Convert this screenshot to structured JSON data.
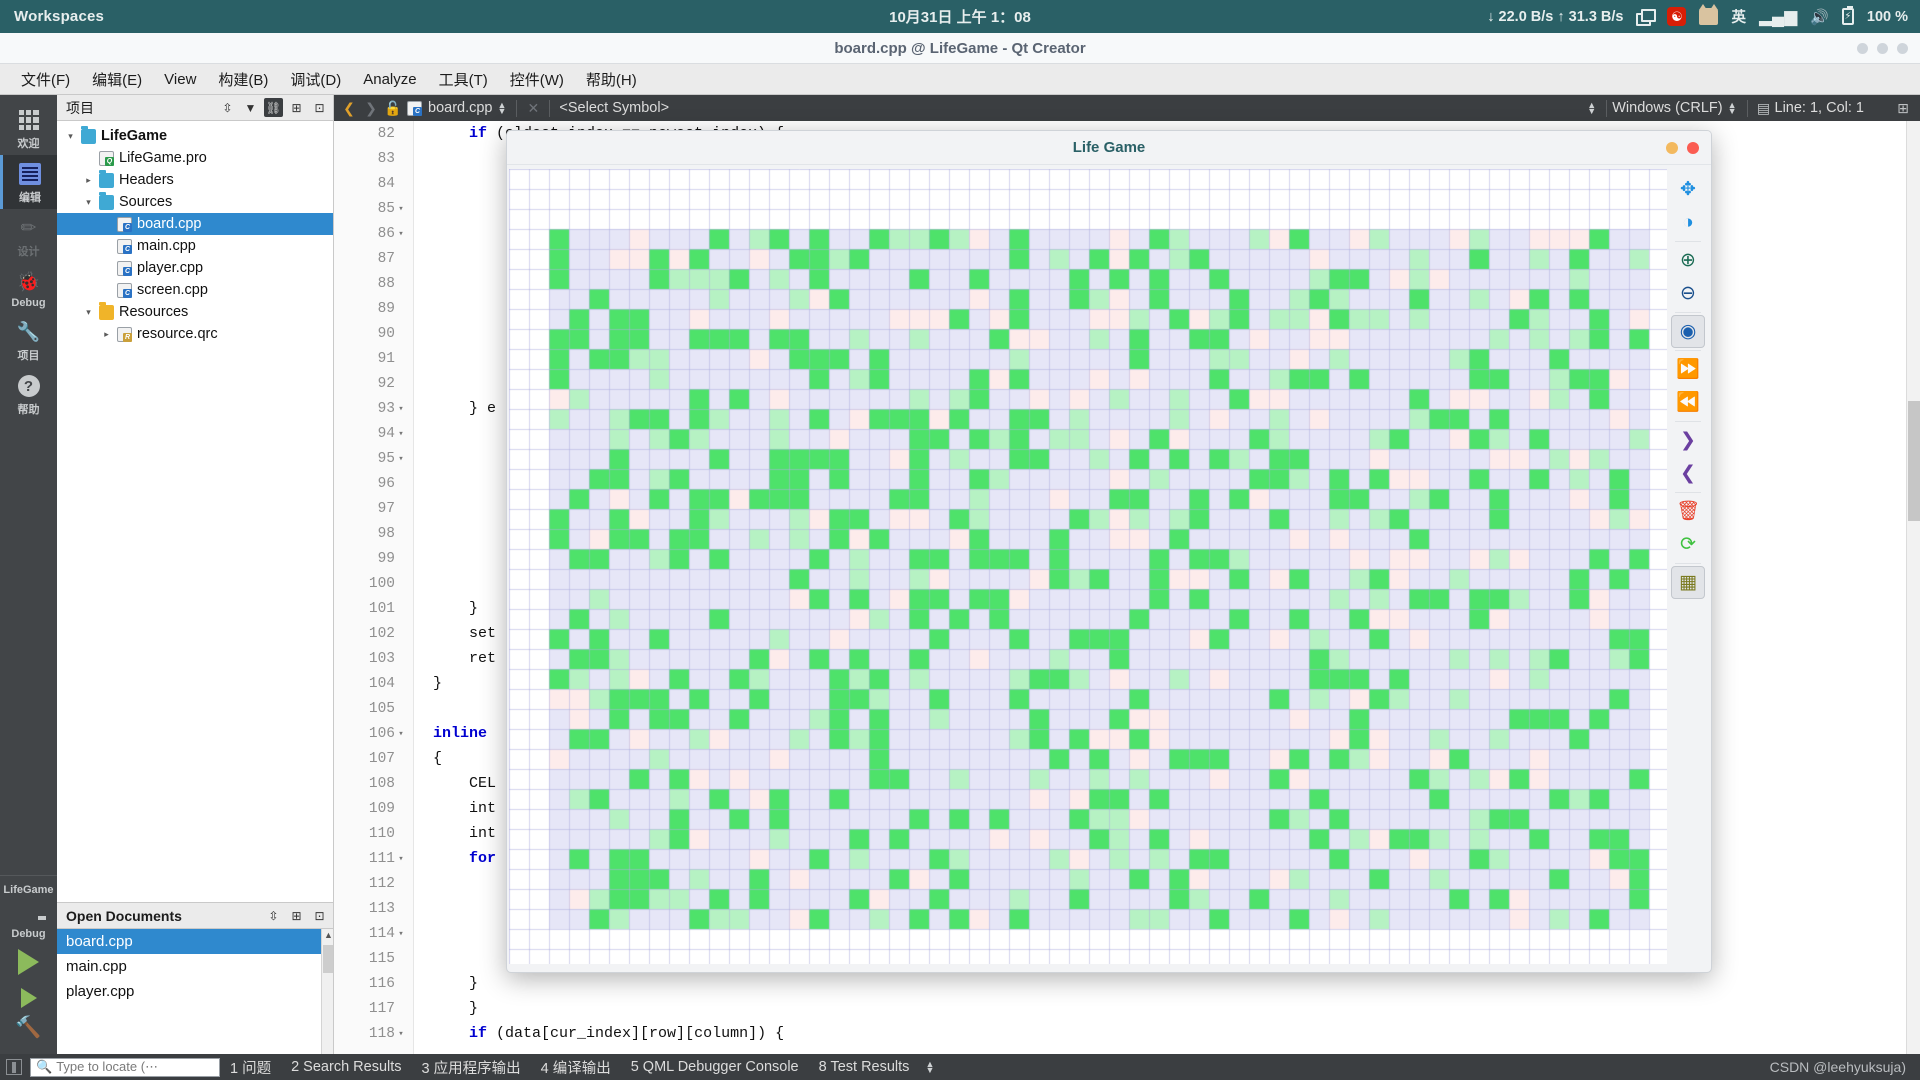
{
  "systembar": {
    "workspaces": "Workspaces",
    "clock": "10月31日 上午 1：08",
    "network": "↓ 22.0 B/s ↑ 31.3 B/s",
    "ime": "英",
    "battery": "100 %",
    "icons": [
      "windows-switch-icon",
      "netease-music-icon",
      "cat-icon",
      "wifi-icon",
      "volume-icon",
      "battery-icon"
    ],
    "bg": "#2a6066"
  },
  "qt_window": {
    "title": "board.cpp @ LifeGame - Qt Creator"
  },
  "menubar": {
    "items": [
      {
        "label": "文件(F)"
      },
      {
        "label": "编辑(E)"
      },
      {
        "label": "View"
      },
      {
        "label": "构建(B)"
      },
      {
        "label": "调试(D)"
      },
      {
        "label": "Analyze"
      },
      {
        "label": "工具(T)"
      },
      {
        "label": "控件(W)"
      },
      {
        "label": "帮助(H)"
      }
    ]
  },
  "modebar": {
    "items": [
      {
        "label": "欢迎",
        "icon": "grid-icon",
        "state": "normal"
      },
      {
        "label": "编辑",
        "icon": "edit-lines-icon",
        "state": "active"
      },
      {
        "label": "设计",
        "icon": "pencil-icon",
        "state": "disabled"
      },
      {
        "label": "Debug",
        "icon": "bug-icon",
        "state": "normal"
      },
      {
        "label": "项目",
        "icon": "wrench-icon",
        "state": "normal"
      },
      {
        "label": "帮助",
        "icon": "question-circle-icon",
        "state": "normal"
      }
    ],
    "kit": {
      "project": "LifeGame",
      "build_config": "Debug",
      "icon": "monitor-icon"
    },
    "run_buttons": [
      {
        "name": "run-button",
        "icon": "play-triangle-icon"
      },
      {
        "name": "debug-button",
        "icon": "play-bug-icon"
      },
      {
        "name": "build-button",
        "icon": "hammer-icon"
      }
    ]
  },
  "project_panel": {
    "title": "项目",
    "header_buttons": [
      "sort-stepper-icon",
      "filter-icon",
      "link-sync-icon",
      "split-icon",
      "close-panel-icon"
    ],
    "tree": [
      {
        "label": "LifeGame",
        "depth": 0,
        "arrow": "▾",
        "icon": "project-folder-icon",
        "bold": true,
        "selected": false
      },
      {
        "label": "LifeGame.pro",
        "depth": 1,
        "arrow": "",
        "icon": "qt-pro-file-icon",
        "bold": false,
        "selected": false
      },
      {
        "label": "Headers",
        "depth": 1,
        "arrow": "▸",
        "icon": "headers-folder-icon",
        "bold": false,
        "selected": false
      },
      {
        "label": "Sources",
        "depth": 1,
        "arrow": "▾",
        "icon": "sources-folder-icon",
        "bold": false,
        "selected": false
      },
      {
        "label": "board.cpp",
        "depth": 2,
        "arrow": "",
        "icon": "cpp-file-icon",
        "bold": false,
        "selected": true
      },
      {
        "label": "main.cpp",
        "depth": 2,
        "arrow": "",
        "icon": "cpp-file-icon",
        "bold": false,
        "selected": false
      },
      {
        "label": "player.cpp",
        "depth": 2,
        "arrow": "",
        "icon": "cpp-file-icon",
        "bold": false,
        "selected": false
      },
      {
        "label": "screen.cpp",
        "depth": 2,
        "arrow": "",
        "icon": "cpp-file-icon",
        "bold": false,
        "selected": false
      },
      {
        "label": "Resources",
        "depth": 1,
        "arrow": "▾",
        "icon": "resources-folder-icon",
        "bold": false,
        "selected": false
      },
      {
        "label": "resource.qrc",
        "depth": 2,
        "arrow": "▸",
        "icon": "qrc-file-icon",
        "bold": false,
        "selected": false
      }
    ]
  },
  "open_documents": {
    "title": "Open Documents",
    "header_buttons": [
      "sort-stepper-icon",
      "split-icon",
      "close-panel-icon"
    ],
    "items": [
      {
        "label": "board.cpp",
        "selected": true
      },
      {
        "label": "main.cpp",
        "selected": false
      },
      {
        "label": "player.cpp",
        "selected": false
      }
    ]
  },
  "editor_toolbar": {
    "back_icon": "chevron-left-icon",
    "forward_icon": "chevron-right-icon",
    "lock_icon": "unlock-icon",
    "file_icon": "cpp-file-icon",
    "filename": "board.cpp",
    "file_stepper": "stepper-icon",
    "close_icon": "close-icon",
    "symbol": "<Select Symbol>",
    "symbol_stepper": "stepper-icon",
    "line_ending": "Windows (CRLF)",
    "line_ending_stepper": "stepper-icon",
    "cursor_icon": "text-encoding-icon",
    "cursor_position": "Line: 1, Col: 1",
    "split_icon": "split-icon"
  },
  "editor": {
    "lines": [
      {
        "num": "82",
        "fold": "",
        "text": "    if (oldest_index == newest_index) {",
        "kw": "if"
      },
      {
        "num": "83",
        "fold": "",
        "text": ""
      },
      {
        "num": "84",
        "fold": "",
        "text": ""
      },
      {
        "num": "85",
        "fold": "▾",
        "text": ""
      },
      {
        "num": "86",
        "fold": "▾",
        "text": ""
      },
      {
        "num": "87",
        "fold": "",
        "text": ""
      },
      {
        "num": "88",
        "fold": "",
        "text": ""
      },
      {
        "num": "89",
        "fold": "",
        "text": ""
      },
      {
        "num": "90",
        "fold": "",
        "text": ""
      },
      {
        "num": "91",
        "fold": "",
        "text": ""
      },
      {
        "num": "92",
        "fold": "",
        "text": ""
      },
      {
        "num": "93",
        "fold": "▾",
        "text": "    } e"
      },
      {
        "num": "94",
        "fold": "▾",
        "text": ""
      },
      {
        "num": "95",
        "fold": "▾",
        "text": ""
      },
      {
        "num": "96",
        "fold": "",
        "text": ""
      },
      {
        "num": "97",
        "fold": "",
        "text": ""
      },
      {
        "num": "98",
        "fold": "",
        "text": ""
      },
      {
        "num": "99",
        "fold": "",
        "text": ""
      },
      {
        "num": "100",
        "fold": "",
        "text": ""
      },
      {
        "num": "101",
        "fold": "",
        "text": "    }"
      },
      {
        "num": "102",
        "fold": "",
        "text": "    set"
      },
      {
        "num": "103",
        "fold": "",
        "text": "    ret"
      },
      {
        "num": "104",
        "fold": "",
        "text": "}"
      },
      {
        "num": "105",
        "fold": "",
        "text": ""
      },
      {
        "num": "106",
        "fold": "▾",
        "text": "inline"
      },
      {
        "num": "107",
        "fold": "",
        "text": "{"
      },
      {
        "num": "108",
        "fold": "",
        "text": "    CEL"
      },
      {
        "num": "109",
        "fold": "",
        "text": "    int"
      },
      {
        "num": "110",
        "fold": "",
        "text": "    int"
      },
      {
        "num": "111",
        "fold": "▾",
        "text": "    for"
      },
      {
        "num": "112",
        "fold": "",
        "text": ""
      },
      {
        "num": "113",
        "fold": "",
        "text": ""
      },
      {
        "num": "114",
        "fold": "▾",
        "text": ""
      },
      {
        "num": "115",
        "fold": "",
        "text": ""
      },
      {
        "num": "116",
        "fold": "",
        "text": "    }"
      },
      {
        "num": "117",
        "fold": "",
        "text": "    }"
      },
      {
        "num": "118",
        "fold": "▾",
        "text": "    if (data[cur_index][row][column]) {"
      }
    ]
  },
  "life_game": {
    "title": "Life Game",
    "window_buttons": [
      "minimize-dot",
      "close-dot"
    ],
    "tools": [
      {
        "name": "move-tool",
        "icon": "move-arrows-icon",
        "color": "#1f8fe0",
        "glyph": "✥",
        "active": false
      },
      {
        "name": "contrast-tool",
        "icon": "contrast-icon",
        "color": "#1f8fe0",
        "glyph": "◑",
        "active": false
      },
      {
        "name": "zoom-in-tool",
        "icon": "zoom-in-icon",
        "color": "#1a6b53",
        "glyph": "⊕",
        "active": false
      },
      {
        "name": "zoom-out-tool",
        "icon": "zoom-out-icon",
        "color": "#1a4f8c",
        "glyph": "⊖",
        "active": false
      },
      {
        "name": "play-tool",
        "icon": "play-circle-icon",
        "color": "#1a5fae",
        "glyph": "◉",
        "active": true
      },
      {
        "name": "fast-forward-tool",
        "icon": "fast-forward-icon",
        "color": "#d61f69",
        "glyph": "⏩",
        "active": false
      },
      {
        "name": "rewind-tool",
        "icon": "rewind-icon",
        "color": "#d61f69",
        "glyph": "⏪",
        "active": false
      },
      {
        "name": "step-forward-tool",
        "icon": "chevron-right-icon",
        "color": "#6b3fa0",
        "glyph": "❯",
        "active": false
      },
      {
        "name": "step-back-tool",
        "icon": "chevron-left-icon",
        "color": "#6b3fa0",
        "glyph": "❮",
        "active": false
      },
      {
        "name": "clear-tool",
        "icon": "trash-icon",
        "color": "#e8402a",
        "glyph": "🗑",
        "active": false
      },
      {
        "name": "reset-tool",
        "icon": "refresh-icon",
        "color": "#3fc13f",
        "glyph": "⟳",
        "active": false
      },
      {
        "name": "grid-tool",
        "icon": "grid-icon",
        "color": "#7a7a1f",
        "glyph": "▦",
        "active": true
      }
    ],
    "grid": {
      "cols": 58,
      "rows": 39,
      "cell_size": 20,
      "colors": {
        "empty": "#e6e6f7",
        "alive": "#4ee26a",
        "dying": "#b6f2c3",
        "dead": "#fdeceb",
        "blank": "#ffffff",
        "gridline": "#aeaee0"
      }
    }
  },
  "statusbar": {
    "toggle_sidebar_icon": "sidebar-toggle-icon",
    "search_icon": "search-icon",
    "locate_placeholder": "Type to locate (⋯",
    "outputs": [
      "1 问题",
      "2 Search Results",
      "3 应用程序输出",
      "4 编译输出",
      "5 QML Debugger Console",
      "8 Test Results"
    ],
    "output_stepper": "stepper-icon",
    "watermark": "CSDN @leehyuksuja)"
  }
}
